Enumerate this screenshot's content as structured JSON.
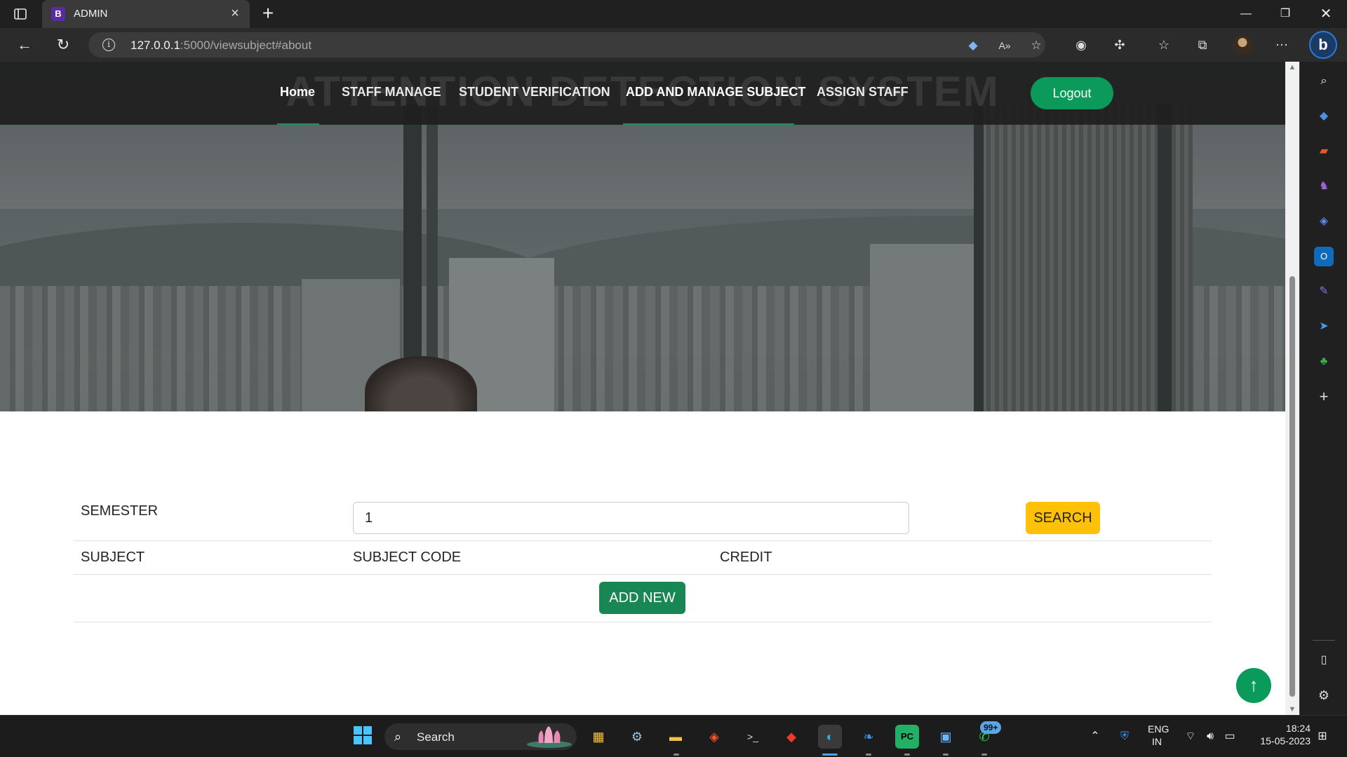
{
  "browser": {
    "tab_title": "ADMIN",
    "tab_favicon": "B",
    "url_host": "127.0.0.1",
    "url_rest": ":5000/viewsubject#about",
    "colors": {
      "chrome_bg": "#202020",
      "tab_active": "#3a3a3a",
      "url_box": "#3b3b3b"
    }
  },
  "site": {
    "logo_text": "ATTENTION DETECTION SYSTEM",
    "nav": [
      {
        "label": "Home"
      },
      {
        "label": "STAFF MANAGE"
      },
      {
        "label": "STUDENT VERIFICATION"
      },
      {
        "label": "ADD AND MANAGE SUBJECT"
      },
      {
        "label": "ASSIGN STAFF"
      }
    ],
    "logout_label": "Logout",
    "colors": {
      "accent_green": "#0b9a5a",
      "header_bg": "#1f1f1f"
    }
  },
  "subject_form": {
    "semester_label": "SEMESTER",
    "semester_value": "1",
    "search_label": "SEARCH",
    "columns": [
      "SUBJECT",
      "SUBJECT CODE",
      "CREDIT"
    ],
    "rows": [],
    "add_new_label": "ADD NEW",
    "colors": {
      "search_btn": "#ffc107",
      "add_btn": "#198754"
    }
  },
  "back_to_top_icon": "arrow-up-icon",
  "taskbar": {
    "search_label": "Search",
    "whatsapp_badge": "99+",
    "language": "ENG",
    "region": "IN",
    "time": "18:24",
    "date": "15-05-2023"
  }
}
